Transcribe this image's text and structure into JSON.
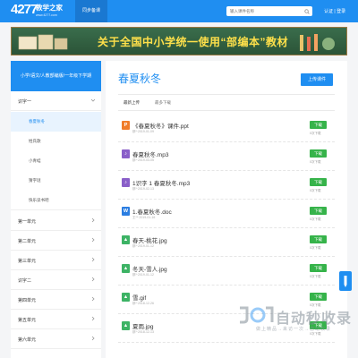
{
  "header": {
    "logo_number": "4277",
    "logo_name": "教学之家",
    "logo_site": "www.4277.com",
    "nav_tab": "同步备课",
    "search_placeholder": "输入课件名称",
    "auth": "认证 | 登录"
  },
  "banner": {
    "text": "关于全国中小学统一使用“部编本”教材"
  },
  "sidebar": {
    "heading": "小学/语文/人教部编版/一年级下学期",
    "items": [
      {
        "label": "识字一",
        "type": "group",
        "expanded": true
      },
      {
        "label": "春夏秋冬",
        "type": "sub",
        "active": true
      },
      {
        "label": "姓氏歌",
        "type": "sub"
      },
      {
        "label": "小青蛙",
        "type": "sub"
      },
      {
        "label": "猜字谜",
        "type": "sub"
      },
      {
        "label": "快乐读书吧",
        "type": "sub"
      },
      {
        "label": "第一单元",
        "type": "group"
      },
      {
        "label": "第二单元",
        "type": "group"
      },
      {
        "label": "第三单元",
        "type": "group"
      },
      {
        "label": "识字二",
        "type": "group"
      },
      {
        "label": "第四单元",
        "type": "group"
      },
      {
        "label": "第五单元",
        "type": "group"
      },
      {
        "label": "第六单元",
        "type": "group"
      }
    ]
  },
  "main": {
    "title": "春夏秋冬",
    "upload_label": "上传课件",
    "sort_latest": "最新上传",
    "sort_downloads": "最多下载",
    "download_label": "下载",
    "files": [
      {
        "name": "《春夏秋冬》课件.ppt",
        "meta": "那*·2019-01-09",
        "downloads": "0次下载",
        "icon": "P",
        "color": "#f07c2a"
      },
      {
        "name": "春夏秋冬.mp3",
        "meta": "那*·2019-03-05",
        "downloads": "0次下载",
        "icon": "♪",
        "color": "#8a5fc9"
      },
      {
        "name": "1识字 1 春夏秋冬.mp3",
        "meta": "那*·2019-02-13",
        "downloads": "0次下载",
        "icon": "♪",
        "color": "#8a5fc9"
      },
      {
        "name": "1.春夏秋冬.doc",
        "meta": "王**·2019-01-16",
        "downloads": "0次下载",
        "icon": "W",
        "color": "#2a7de1"
      },
      {
        "name": "春天-桃花.jpg",
        "meta": "那*·2019-01-12",
        "downloads": "0次下载",
        "icon": "▲",
        "color": "#3db365"
      },
      {
        "name": "冬天-雪人.jpg",
        "meta": "那*·2019-01-12",
        "downloads": "0次下载",
        "icon": "▲",
        "color": "#3db365"
      },
      {
        "name": "雪.gif",
        "meta": "那*·2018-12-26",
        "downloads": "0次下载",
        "icon": "▲",
        "color": "#3db365"
      },
      {
        "name": "夏雨.jpg",
        "meta": "那*·2018-12-13",
        "downloads": "0次下载",
        "icon": "▲",
        "color": "#3db365"
      }
    ]
  },
  "watermark": {
    "big": "自动秒收录",
    "small": "做上精品→来访一次→自动收录"
  }
}
